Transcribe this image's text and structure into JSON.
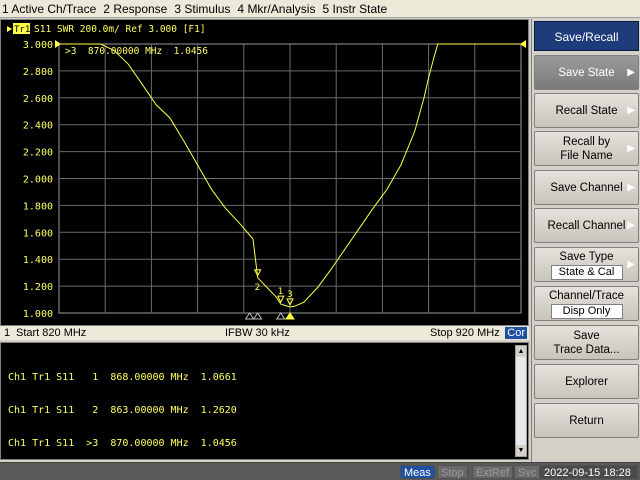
{
  "menu": [
    {
      "num": "1",
      "label": "Active Ch/Trace"
    },
    {
      "num": "2",
      "label": "Response"
    },
    {
      "num": "3",
      "label": "Stimulus"
    },
    {
      "num": "4",
      "label": "Mkr/Analysis"
    },
    {
      "num": "5",
      "label": "Instr State"
    }
  ],
  "trace_header": {
    "badge": "Tr1",
    "text": "S11  SWR 200.0m/ Ref 3.000 [F1]"
  },
  "active_marker_readout": ">3  870.00000 MHz  1.0456",
  "y_ticks": [
    "3.000",
    "2.800",
    "2.600",
    "2.400",
    "2.200",
    "2.000",
    "1.800",
    "1.600",
    "1.400",
    "1.200",
    "1.000"
  ],
  "stimulus_bar": {
    "channel": "1",
    "start": "Start 820 MHz",
    "ifbw": "IFBW 30 kHz",
    "stop": "Stop 920 MHz",
    "cor": "Cor"
  },
  "markers_table": [
    "Ch1 Tr1 S11   1  868.00000 MHz  1.0661",
    "Ch1 Tr1 S11   2  863.00000 MHz  1.2620",
    "Ch1 Tr1 S11  >3  870.00000 MHz  1.0456"
  ],
  "marker_labels": [
    "1",
    "2",
    "3"
  ],
  "softkeys": {
    "title": "Save/Recall",
    "save_state": "Save State",
    "recall_state": "Recall State",
    "recall_by_file_line1": "Recall by",
    "recall_by_file_line2": "File Name",
    "save_channel": "Save Channel",
    "recall_channel": "Recall Channel",
    "save_type_label": "Save Type",
    "save_type_value": "State & Cal",
    "channel_trace_label": "Channel/Trace",
    "channel_trace_value": "Disp Only",
    "save_trace_data_line1": "Save",
    "save_trace_data_line2": "Trace Data...",
    "explorer": "Explorer",
    "return": "Return"
  },
  "statusbar": {
    "meas": "Meas",
    "stop": "Stop",
    "extref": "ExtRef",
    "svc": "Svc",
    "datetime": "2022-09-15 18:28"
  },
  "chart_data": {
    "type": "line",
    "title": "S11  SWR 200.0m/ Ref 3.000 [F1]",
    "xlabel": "",
    "ylabel": "",
    "xlim": [
      820,
      920
    ],
    "ylim": [
      1.0,
      3.0
    ],
    "grid": true,
    "trace_color": "#ffff44",
    "series": [
      {
        "name": "Tr1",
        "x": [
          820,
          823,
          826,
          829,
          832,
          835,
          838,
          841,
          844,
          847,
          850,
          853,
          856,
          859,
          862,
          863,
          865,
          867,
          868,
          869,
          870,
          871,
          873,
          876,
          879,
          882,
          885,
          888,
          891,
          894,
          897,
          899,
          900,
          901,
          902,
          905,
          910,
          915,
          920
        ],
        "y": [
          3.0,
          3.0,
          3.0,
          3.0,
          2.95,
          2.85,
          2.7,
          2.55,
          2.45,
          2.28,
          2.1,
          1.92,
          1.78,
          1.67,
          1.55,
          1.262,
          1.19,
          1.12,
          1.0661,
          1.055,
          1.0456,
          1.05,
          1.08,
          1.19,
          1.33,
          1.48,
          1.63,
          1.78,
          1.92,
          2.1,
          2.35,
          2.6,
          2.75,
          2.88,
          3.0,
          3.0,
          3.0,
          3.0,
          3.0
        ]
      }
    ],
    "markers": [
      {
        "id": "1",
        "x": 868,
        "y": 1.0661
      },
      {
        "id": "2",
        "x": 863,
        "y": 1.262
      },
      {
        "id": "3",
        "x": 870,
        "y": 1.0456,
        "active": true
      }
    ]
  }
}
